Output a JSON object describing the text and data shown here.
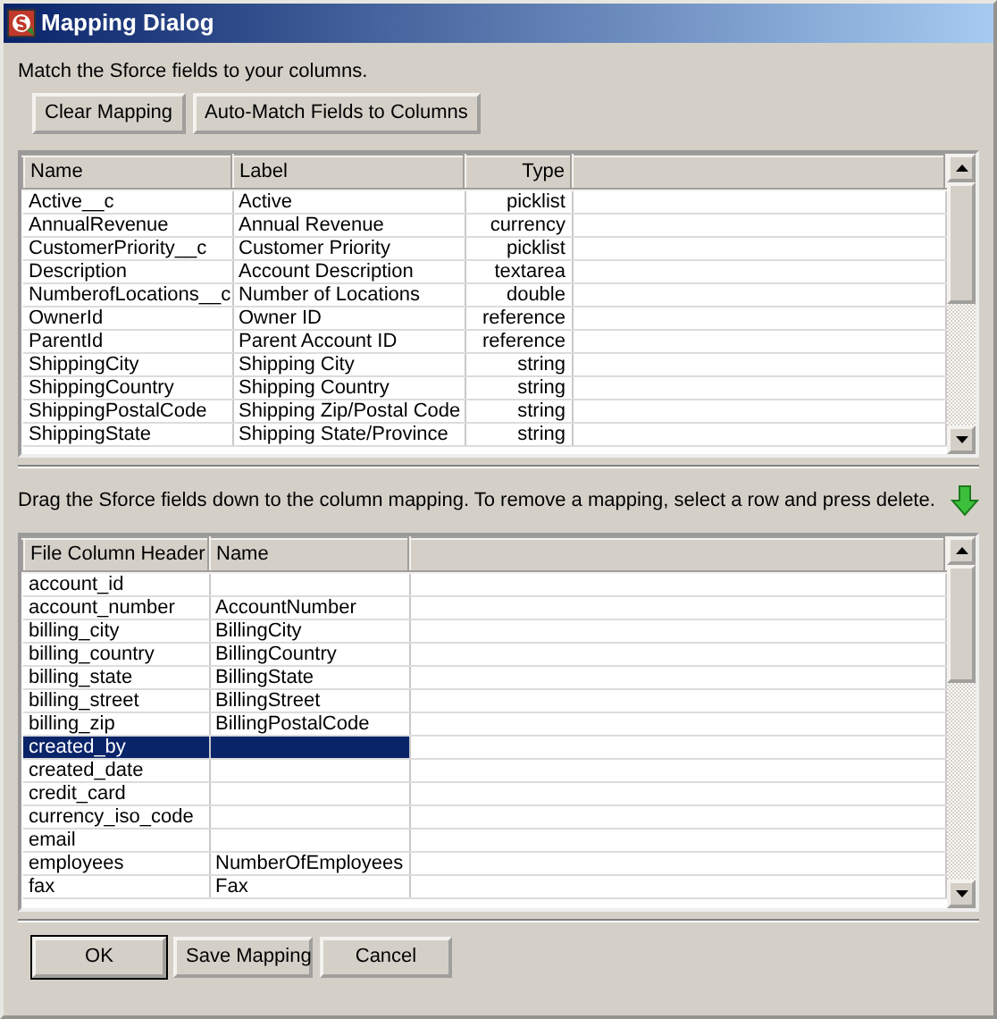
{
  "window": {
    "title": "Mapping Dialog"
  },
  "instruction": "Match the Sforce fields to your columns.",
  "toolbar_buttons": [
    "Clear Mapping",
    "Auto-Match Fields to Columns"
  ],
  "fields_table": {
    "columns": [
      "Name",
      "Label",
      "Type"
    ],
    "rows": [
      [
        "Active__c",
        "Active",
        "picklist"
      ],
      [
        "AnnualRevenue",
        "Annual Revenue",
        "currency"
      ],
      [
        "CustomerPriority__c",
        "Customer Priority",
        "picklist"
      ],
      [
        "Description",
        "Account Description",
        "textarea"
      ],
      [
        "NumberofLocations__c",
        "Number of Locations",
        "double"
      ],
      [
        "OwnerId",
        "Owner ID",
        "reference"
      ],
      [
        "ParentId",
        "Parent Account ID",
        "reference"
      ],
      [
        "ShippingCity",
        "Shipping City",
        "string"
      ],
      [
        "ShippingCountry",
        "Shipping Country",
        "string"
      ],
      [
        "ShippingPostalCode",
        "Shipping Zip/Postal Code",
        "string"
      ],
      [
        "ShippingState",
        "Shipping State/Province",
        "string"
      ]
    ]
  },
  "drag_hint": "Drag the Sforce fields down to the column mapping.  To remove a mapping, select a row and press delete.",
  "mapping_table": {
    "columns": [
      "File Column Header",
      "Name"
    ],
    "rows": [
      {
        "cells": [
          "account_id",
          ""
        ],
        "selected": false
      },
      {
        "cells": [
          "account_number",
          "AccountNumber"
        ],
        "selected": false
      },
      {
        "cells": [
          "billing_city",
          "BillingCity"
        ],
        "selected": false
      },
      {
        "cells": [
          "billing_country",
          "BillingCountry"
        ],
        "selected": false
      },
      {
        "cells": [
          "billing_state",
          "BillingState"
        ],
        "selected": false
      },
      {
        "cells": [
          "billing_street",
          "BillingStreet"
        ],
        "selected": false
      },
      {
        "cells": [
          "billing_zip",
          "BillingPostalCode"
        ],
        "selected": false
      },
      {
        "cells": [
          "created_by",
          ""
        ],
        "selected": true
      },
      {
        "cells": [
          "created_date",
          ""
        ],
        "selected": false
      },
      {
        "cells": [
          "credit_card",
          ""
        ],
        "selected": false
      },
      {
        "cells": [
          "currency_iso_code",
          ""
        ],
        "selected": false
      },
      {
        "cells": [
          "email",
          ""
        ],
        "selected": false
      },
      {
        "cells": [
          "employees",
          "NumberOfEmployees"
        ],
        "selected": false
      },
      {
        "cells": [
          "fax",
          "Fax"
        ],
        "selected": false
      }
    ]
  },
  "dialog_buttons": [
    "OK",
    "Save Mapping",
    "Cancel"
  ]
}
